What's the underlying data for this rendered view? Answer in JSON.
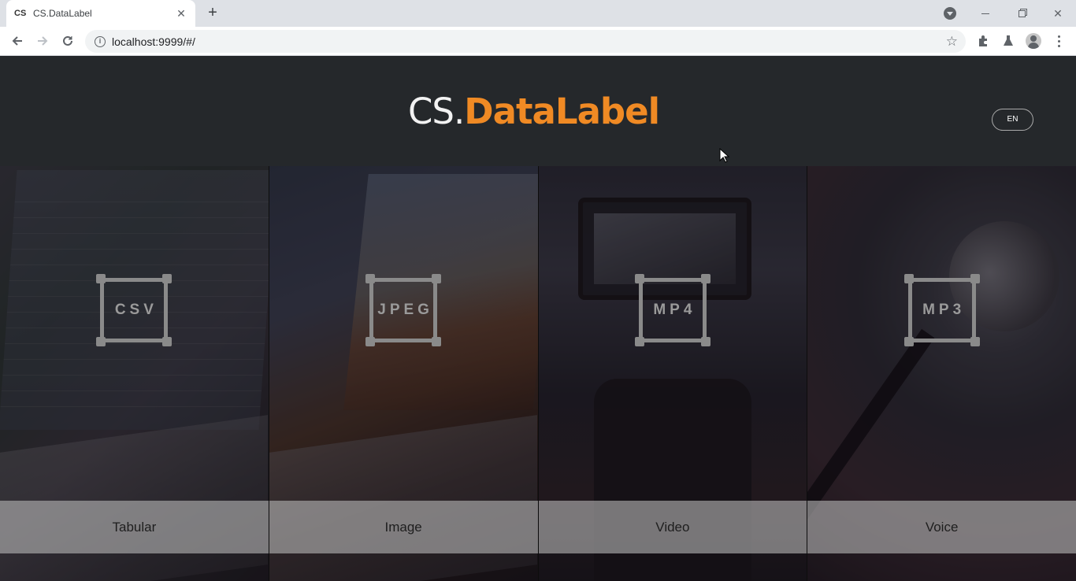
{
  "browser": {
    "tab": {
      "favicon": "CS",
      "title": "CS.DataLabel",
      "close_icon": "close-icon"
    },
    "new_tab_label": "+",
    "url": "localhost:9999/#/",
    "icons": [
      "back-arrow-icon",
      "forward-arrow-icon",
      "reload-icon",
      "info-icon",
      "star-icon",
      "puzzle-icon",
      "labs-flask-icon",
      "profile-icon",
      "menu-dots-icon"
    ]
  },
  "header": {
    "logo_prefix": "CS.",
    "logo_brand": "DataLabel",
    "lang_button": "EN",
    "brand_color": "#f08a24"
  },
  "cards": [
    {
      "ext": "CSV",
      "caption": "Tabular"
    },
    {
      "ext": "JPEG",
      "caption": "Image"
    },
    {
      "ext": "MP4",
      "caption": "Video"
    },
    {
      "ext": "MP3",
      "caption": "Voice"
    }
  ]
}
